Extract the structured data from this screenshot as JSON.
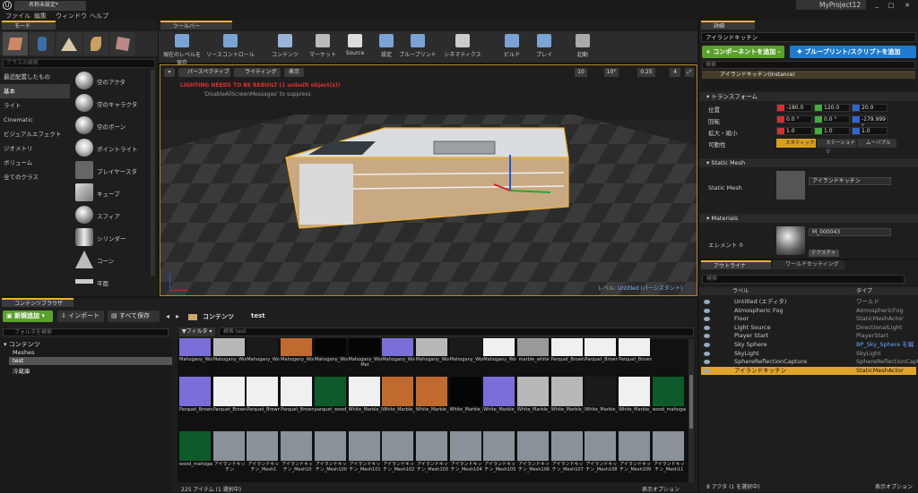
{
  "window": {
    "tab_title": "名称未設定*",
    "project_name": "MyProject12"
  },
  "menu": [
    "ファイル",
    "編集",
    "ウィンドウ",
    "ヘルプ"
  ],
  "modes": {
    "tab": "モード",
    "search_placeholder": "クラスの検索",
    "categories": [
      "最近配置したもの",
      "基本",
      "ライト",
      "Cinematic",
      "ビジュアルエフェクト",
      "ジオメトリ",
      "ボリューム",
      "全てのクラス"
    ],
    "selected_category": "基本",
    "actors": [
      "空のアクタ",
      "空のキャラクタ",
      "空のポーン",
      "ポイントライト",
      "プレイヤースタ",
      "キューブ",
      "スフィア",
      "シリンダー",
      "コーン",
      "平面"
    ]
  },
  "toolbar": {
    "tab": "ツールバー",
    "buttons": [
      "現在のレベルを保存",
      "ソースコントロール",
      "コンテンツ",
      "マーケット",
      "Source",
      "設定",
      "ブループリント",
      "シネマティクス",
      "ビルド",
      "プレイ",
      "起動"
    ]
  },
  "viewport": {
    "perspective": "パースペクティブ",
    "lighting": "ライティング",
    "show": "表示",
    "warning": "LIGHTING NEEDS TO BE REBUILT (1 unbuilt object(s))",
    "suppress": "'DisableAllScreenMessages' to suppress",
    "grid": "10",
    "angle": "10°",
    "scale": "0.25",
    "camera_speed": "4",
    "level_label": "レベル:",
    "level_name": "Untitled (パーシスタント)"
  },
  "details": {
    "tab": "詳細",
    "actor_name": "アイランドキッチン",
    "add_component": "+ コンポーネントを追加 -",
    "blueprint_button": "ブループリント/スクリプトを追加",
    "search_placeholder": "検索",
    "instance": "アイランドキッチン(Instance)",
    "transform_section": "トランスフォーム",
    "location_label": "位置",
    "rotation_label": "回転",
    "scale_label": "拡大・縮小",
    "mobility_label": "可動性",
    "location": [
      "-180.0",
      "120.0",
      "20.0"
    ],
    "rotation": [
      "0.0 °",
      "0.0 °",
      "-179.999 °"
    ],
    "scale": [
      "1.0",
      "1.0",
      "1.0"
    ],
    "mobility": [
      "スタティック",
      "ステーショナリ",
      "ムーバブル"
    ],
    "static_mesh_section": "Static Mesh",
    "static_mesh_label": "Static Mesh",
    "static_mesh_value": "アイランドキッチン",
    "materials_section": "Materials",
    "element_label": "エレメント 0",
    "material_value": "M_000043",
    "texture_label": "テクスチャ"
  },
  "outliner": {
    "tab": "アウトライナ",
    "tab2": "ワールドセッティング",
    "search_placeholder": "検索",
    "col_label": "ラベル",
    "col_type": "タイプ",
    "rows": [
      {
        "label": "Untitled (エディタ)",
        "type": "ワールド"
      },
      {
        "label": "Atmospheric Fog",
        "type": "AtmosphericFog"
      },
      {
        "label": "Floor",
        "type": "StaticMeshActor"
      },
      {
        "label": "Light Source",
        "type": "DirectionalLight"
      },
      {
        "label": "Player Start",
        "type": "PlayerStart"
      },
      {
        "label": "Sky Sphere",
        "type": "BP_Sky_Sphere を編"
      },
      {
        "label": "SkyLight",
        "type": "SkyLight"
      },
      {
        "label": "SphereReflectionCapture",
        "type": "SphereReflectionCapture"
      },
      {
        "label": "アイランドキッチン",
        "type": "StaticMeshActor"
      }
    ],
    "footer": "8 アクタ (1 を選択中)",
    "view_options": "表示オプション"
  },
  "content": {
    "tab": "コンテンツブラウザ",
    "add_new": "新規追加",
    "import": "インポート",
    "save_all": "すべて保存",
    "path_root": "コンテンツ",
    "path_folder": "test",
    "filter": "フィルタ",
    "search_placeholder": "検索 test",
    "folder_search": "フォルダを検索",
    "tree": [
      "コンテンツ",
      "Meshes",
      "test",
      "冷蔵庫"
    ],
    "row1": [
      "Mahogany_Wood_INST1_normal",
      "Mahogany_Wood_INST1_roughness",
      "Mahogany_Wood_INST1_specular",
      "Mahogany_Wood_INST_basecolor",
      "Mahogany_Wood_INST_metallic",
      "Mahogany_Wood_INST_metallic Mat",
      "Mahogany_Wood_INST_normal",
      "Mahogany_Wood_INST_roughness",
      "Mahogany_Wood_INST_specular",
      "Mahogany_Wood_MAT",
      "marble_white",
      "Parquet_Brown_Oak_INST",
      "Parquet_Brown_Oak_INST",
      "Parquet_Brown_Oak_INST"
    ],
    "row2": [
      "Parquet_Brown_Oak_INST_normal",
      "Parquet_Brown_Oak_INST",
      "Parquet_Brown_Oak_INST",
      "Parquet_Brown_Oak_MAT",
      "parquet_wood_oak_brown",
      "White_Marble_INST",
      "White_Marble_INST_basecolor",
      "White_Marble_INST_basecolor",
      "White_Marble_INST_metallic",
      "White_Marble_INST_normal",
      "White_Marble_INST_roughness",
      "White_Marble_INST_roughness",
      "White_Marble_INST_specular",
      "White_Marble_MAT",
      "wood_mahogany"
    ],
    "row3": [
      "wood_mahogany_2",
      "アイランドキッチン",
      "アイランドキッチン_Mesh1",
      "アイランドキッチン_Mesh10",
      "アイランドキッチン_Mesh100",
      "アイランドキッチン_Mesh101",
      "アイランドキッチン_Mesh102",
      "アイランドキッチン_Mesh103",
      "アイランドキッチン_Mesh104",
      "アイランドキッチン_Mesh105",
      "アイランドキッチン_Mesh106",
      "アイランドキッチン_Mesh107",
      "アイランドキッチン_Mesh108",
      "アイランドキッチン_Mesh109",
      "アイランドキッチン_Mesh11"
    ],
    "footer": "225 アイテム (1 選択中)",
    "view_options": "表示オプション"
  }
}
